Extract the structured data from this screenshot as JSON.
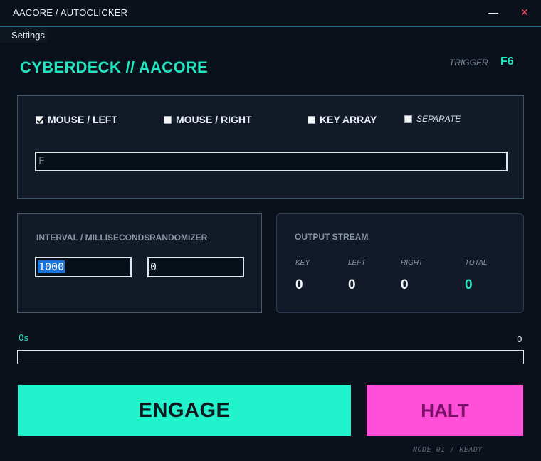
{
  "window": {
    "title": "AACORE  /  AUTOCLICKER",
    "minimize_icon": "minimize-icon",
    "close_icon": "close-icon",
    "close_glyph": "✕"
  },
  "menu": {
    "settings": "Settings"
  },
  "header": {
    "brand": "CYBERDECK // AACORE",
    "trigger_label": "TRIGGER",
    "trigger_key": "F6"
  },
  "mode": {
    "options": [
      {
        "label": "MOUSE / LEFT",
        "checked": true
      },
      {
        "label": "MOUSE / RIGHT",
        "checked": false
      },
      {
        "label": "KEY ARRAY",
        "checked": false
      },
      {
        "label": "SEPARATE",
        "checked": false
      }
    ],
    "key_value": "E"
  },
  "timing": {
    "interval_label": "INTERVAL / MILLISECONDS",
    "interval_value": "1000",
    "randomizer_label": "RANDOMIZER",
    "randomizer_value": "0"
  },
  "output": {
    "title": "OUTPUT STREAM",
    "columns": [
      {
        "label": "KEY",
        "value": "0"
      },
      {
        "label": "LEFT",
        "value": "0"
      },
      {
        "label": "RIGHT",
        "value": "0"
      },
      {
        "label": "TOTAL",
        "value": "0"
      }
    ]
  },
  "progress": {
    "elapsed": "0s",
    "count": "0",
    "fraction": 0
  },
  "actions": {
    "engage": "ENGAGE",
    "halt": "HALT"
  },
  "status": "NODE 01  /  READY",
  "colors": {
    "accent": "#21e6c1",
    "engage": "#21f3cc",
    "halt": "#ff4fd8",
    "background": "#0b111a"
  }
}
